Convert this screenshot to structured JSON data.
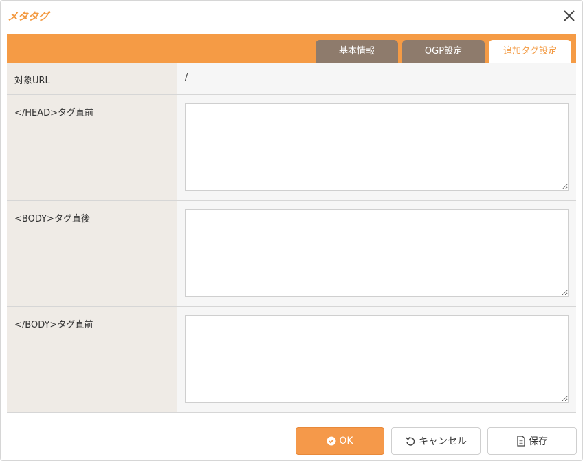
{
  "dialog": {
    "title": "メタタグ"
  },
  "tabs": [
    {
      "label": "基本情報",
      "active": false
    },
    {
      "label": "OGP設定",
      "active": false
    },
    {
      "label": "追加タグ設定",
      "active": true
    }
  ],
  "form": {
    "url": {
      "label": "対象URL",
      "value": "/"
    },
    "head_close": {
      "label": "</HEAD>タグ直前",
      "value": ""
    },
    "body_open": {
      "label": "<BODY>タグ直後",
      "value": ""
    },
    "body_close": {
      "label": "</BODY>タグ直前",
      "value": ""
    }
  },
  "buttons": {
    "ok_label": "OK",
    "cancel_label": "キャンセル",
    "save_label": "保存"
  },
  "colors": {
    "accent": "#f59b45",
    "tab_inactive": "#8e7b6c",
    "label_bg": "#efebe6"
  },
  "icons": {
    "close": "close-icon",
    "ok": "check-circle-icon",
    "cancel": "undo-icon",
    "save": "document-icon"
  }
}
